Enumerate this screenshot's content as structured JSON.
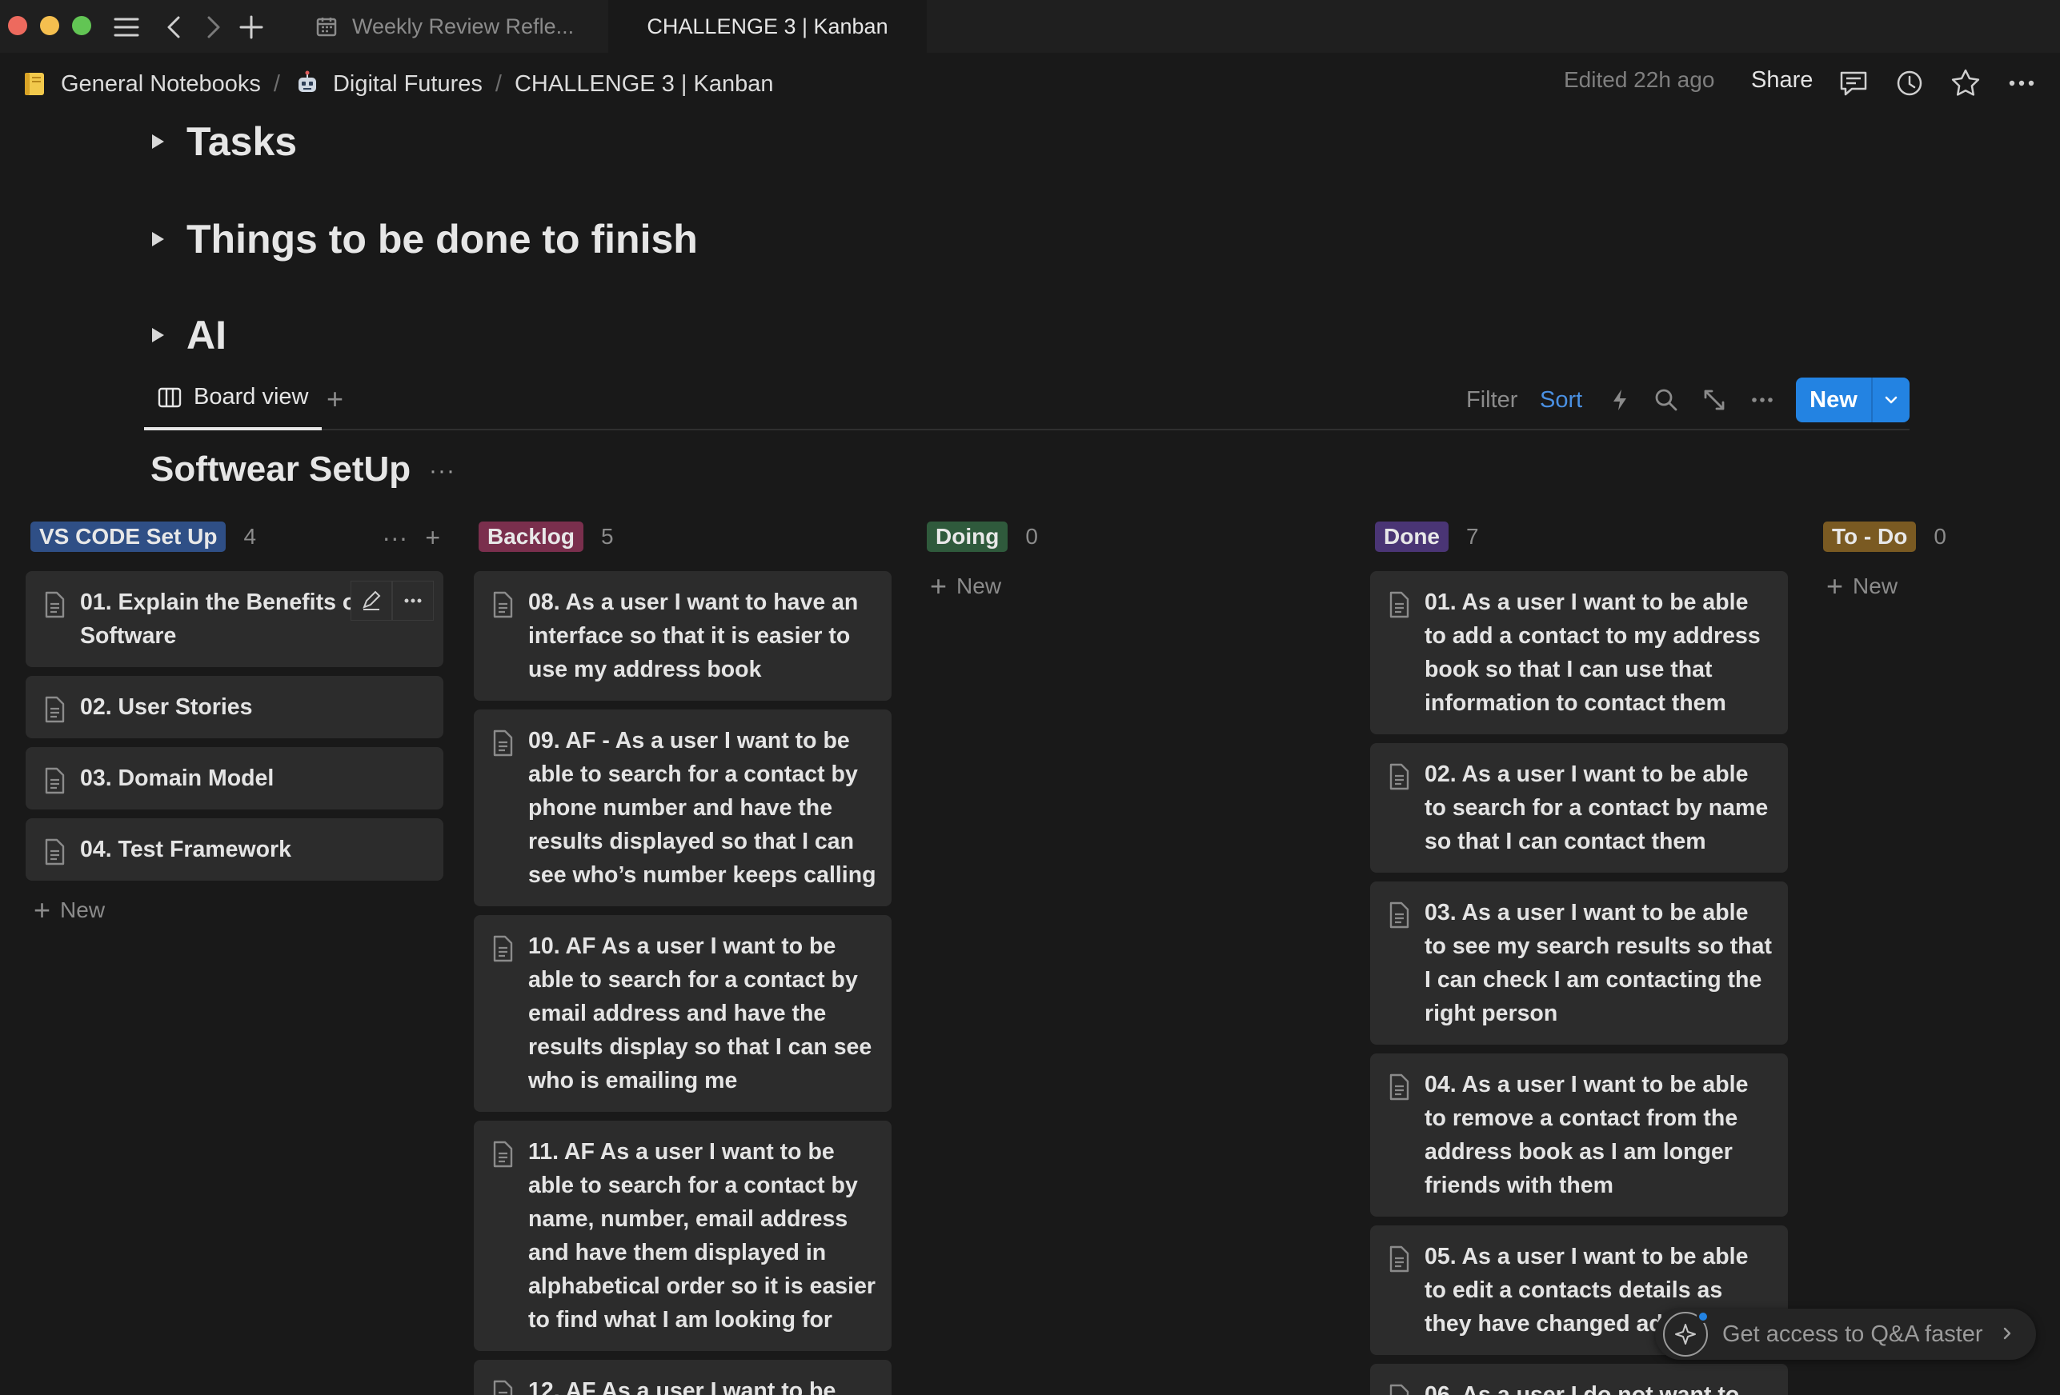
{
  "titlebar": {
    "tabs": [
      {
        "label": "Weekly Review Refle...",
        "icon": "calendar-icon"
      },
      {
        "label": "CHALLENGE 3 | Kanban"
      }
    ]
  },
  "breadcrumb": {
    "items": [
      {
        "label": "General Notebooks",
        "icon": "notebook-emoji"
      },
      {
        "label": "Digital Futures",
        "icon": "robot-emoji"
      },
      {
        "label": "CHALLENGE 3 | Kanban"
      }
    ],
    "separator": "/",
    "edited": "Edited 22h ago",
    "share": "Share"
  },
  "toggles": [
    "Tasks",
    "Things to be done to finish",
    "AI"
  ],
  "database": {
    "view_label": "Board view",
    "add_view": "+",
    "filter": "Filter",
    "sort": "Sort",
    "new_label": "New",
    "group_title": "Softwear SetUp",
    "group_more": "···"
  },
  "board": {
    "new_label": "New",
    "columns": [
      {
        "name": "VS CODE Set Up",
        "count": "4",
        "color": "#2f4f86",
        "cards": [
          {
            "title": "01. Explain the Benefits o",
            "title2": "Software"
          },
          {
            "title": "02. User Stories"
          },
          {
            "title": "03. Domain Model"
          },
          {
            "title": "04. Test Framework"
          }
        ]
      },
      {
        "name": "Backlog",
        "count": "5",
        "color": "#7a2f4d",
        "cards": [
          {
            "title": "08. As a user I want to have an interface so that it is easier to use my address book"
          },
          {
            "title": "09. AF - As a user I want to be able to search for a contact by phone number and have the results displayed so that I can see who’s number keeps calling"
          },
          {
            "title": "10. AF As a user I want to be able to search for a contact by email address and have the results display so that I can see who is emailing me"
          },
          {
            "title": "11. AF As a user I want to be able to search for a contact by name, number, email address and have them displayed in alphabetical order so it is easier to find what I am looking for"
          },
          {
            "title": "12. AF As a user I want to be"
          }
        ]
      },
      {
        "name": "Doing",
        "count": "0",
        "color": "#2f5a3c",
        "cards": []
      },
      {
        "name": "Done",
        "count": "7",
        "color": "#4a3575",
        "cards": [
          {
            "title": "01. As a user I want to be able to add a contact to my address book so that I can use that information to contact them"
          },
          {
            "title": "02. As a user I want to be able to search for a contact by name so that I can contact them"
          },
          {
            "title": "03. As a user I want to be able to see my search results so that I can check I am contacting the right person"
          },
          {
            "title": "04. As a user I want to be able to remove a contact from the address book as I am longer friends with them"
          },
          {
            "title": "05. As a user I want to be able to edit a contacts details as they have changed ad"
          },
          {
            "title": "06. As a user I do not want to"
          }
        ]
      },
      {
        "name": "To - Do",
        "count": "0",
        "color": "#7a5a22",
        "cards": []
      }
    ]
  },
  "hint": {
    "label": "Get access to Q&A faster"
  }
}
